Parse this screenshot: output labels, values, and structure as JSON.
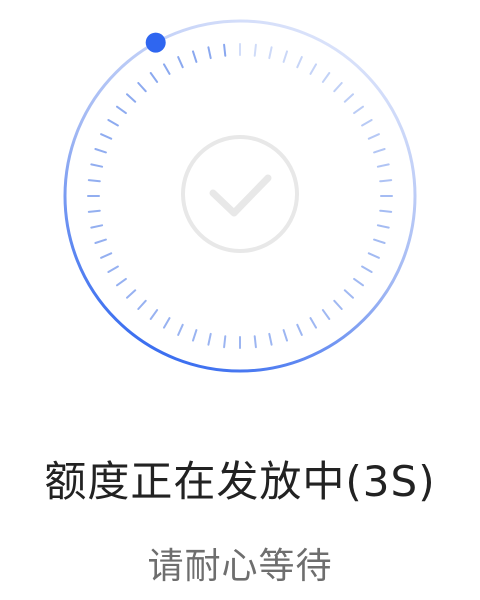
{
  "loader": {
    "progress_fraction": 0.92,
    "accent_color": "#2f66f0",
    "ring_fade_color": "#dfe6fb",
    "tick_color": "#7fa0ee",
    "check_color": "#e8e8e8",
    "icon": "check-icon"
  },
  "status": {
    "title": "额度正在发放中(3S)",
    "subtitle": "请耐心等待"
  }
}
